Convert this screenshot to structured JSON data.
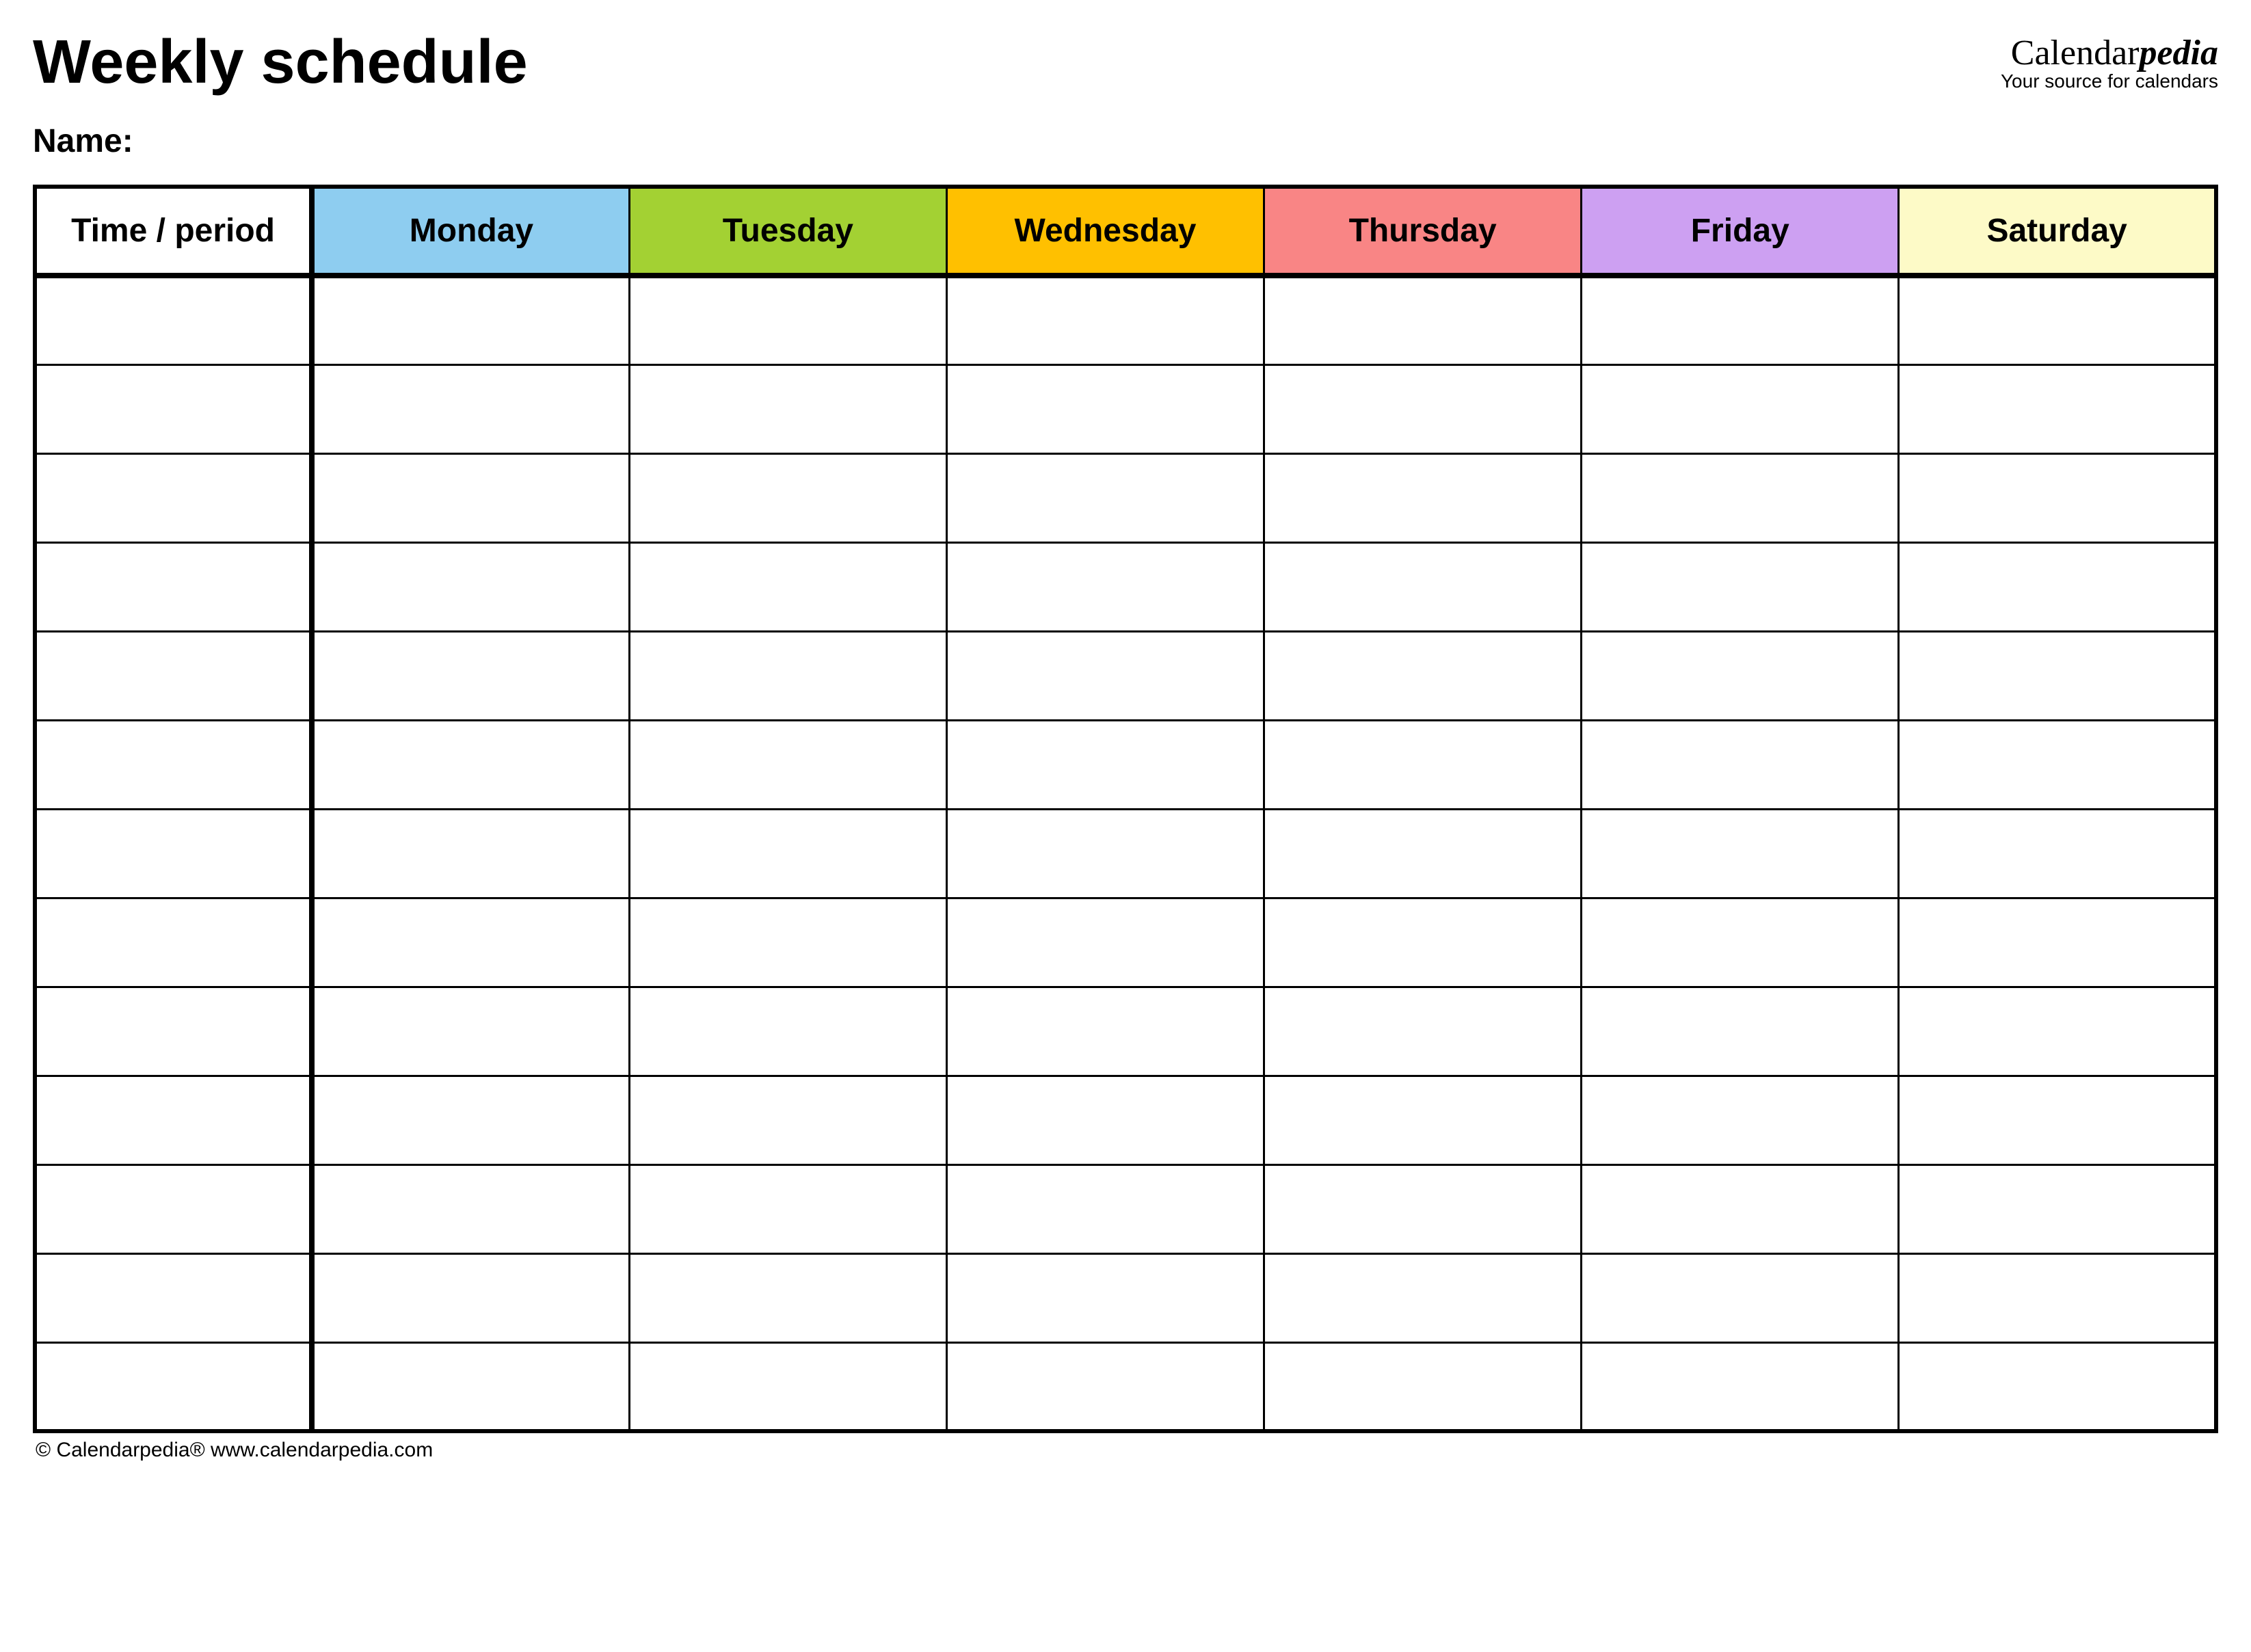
{
  "title": "Weekly schedule",
  "name_label": "Name:",
  "brand": {
    "part1": "Calendar",
    "part2": "pedia",
    "tagline": "Your source for calendars"
  },
  "columns": [
    {
      "label": "Time / period",
      "bg": "#ffffff"
    },
    {
      "label": "Monday",
      "bg": "#8ecdf0"
    },
    {
      "label": "Tuesday",
      "bg": "#a3d133"
    },
    {
      "label": "Wednesday",
      "bg": "#ffc000"
    },
    {
      "label": "Thursday",
      "bg": "#f98585"
    },
    {
      "label": "Friday",
      "bg": "#cda0f2"
    },
    {
      "label": "Saturday",
      "bg": "#fdfac7"
    }
  ],
  "row_count": 13,
  "footer": "© Calendarpedia®   www.calendarpedia.com"
}
